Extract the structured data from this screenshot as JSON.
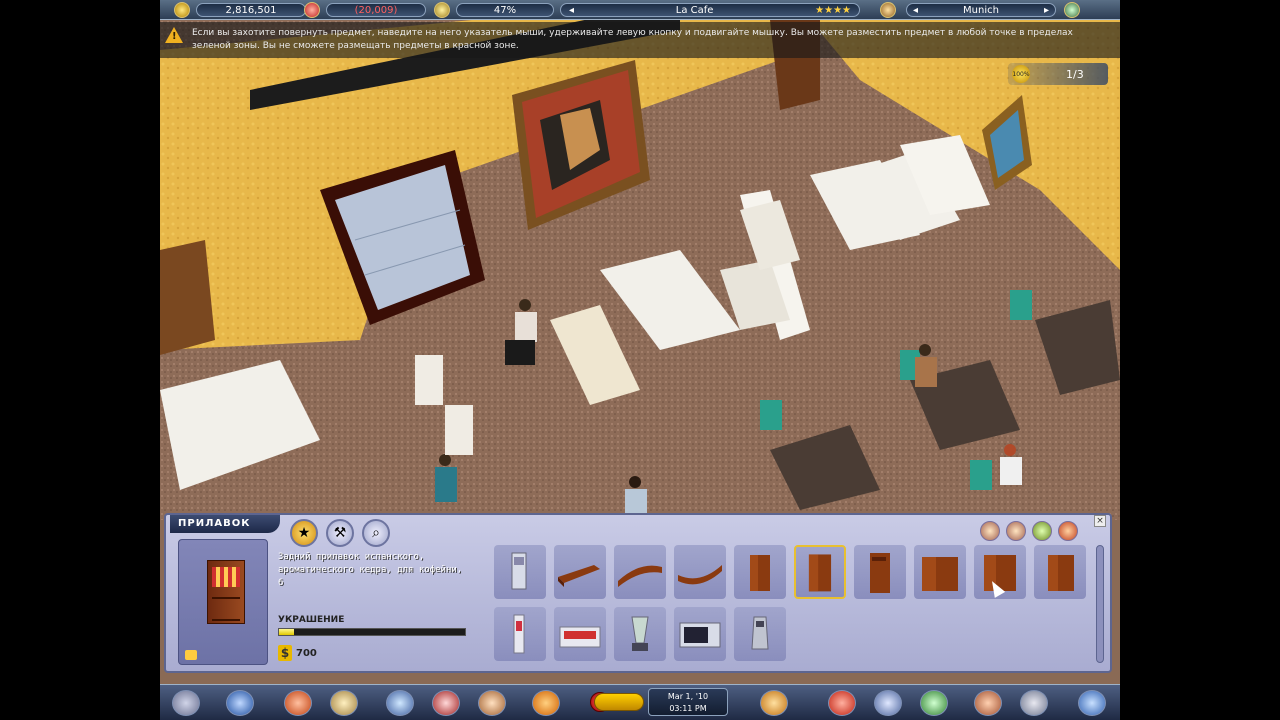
{
  "topbar": {
    "money": "2,816,501",
    "balance": "(20,009)",
    "popularity": "47%",
    "cafe_name": "La Cafe",
    "rating": "★★★★",
    "city": "Munich"
  },
  "hint": {
    "text": "Если вы захотите повернуть предмет, наведите на него указатель мыши, удерживайте левую кнопку и подвигайте мышку. Вы можете разместить предмет в любой точке в пределах зеленой зоны. Вы не сможете размещать предметы в красной зоне."
  },
  "counter": {
    "badge": "100%",
    "value": "1/3"
  },
  "panel": {
    "title": "ПРИЛАВОК",
    "description": "Задний прилавок испанского, ароматического кедра, для кофейни, 6",
    "decor_label": "УКРАШЕНИЕ",
    "decor_level": 0.08,
    "price": "700",
    "close": "×",
    "tools": [
      "star-tool",
      "hammer-tool",
      "magnifier-tool"
    ],
    "categories": [
      "category-1",
      "category-2",
      "category-3",
      "category-4"
    ],
    "items": [
      {
        "name": "coffee-machine-item",
        "selected": false
      },
      {
        "name": "counter-corner-item",
        "selected": false
      },
      {
        "name": "counter-curve-item",
        "selected": false
      },
      {
        "name": "counter-arc-item",
        "selected": false
      },
      {
        "name": "back-counter-item",
        "selected": false
      },
      {
        "name": "back-counter-tall-item",
        "selected": true
      },
      {
        "name": "back-counter-shelf-item",
        "selected": false
      },
      {
        "name": "back-counter-wide-item",
        "selected": false
      },
      {
        "name": "back-counter-double-item",
        "selected": false
      },
      {
        "name": "back-counter-end-item",
        "selected": false
      },
      {
        "name": "juicer-item",
        "selected": false
      },
      {
        "name": "dispenser-item",
        "selected": false
      },
      {
        "name": "blender-item",
        "selected": false
      },
      {
        "name": "microwave-item",
        "selected": false
      },
      {
        "name": "grinder-item",
        "selected": false
      }
    ]
  },
  "clock": {
    "date": "Mar 1, '10",
    "time": "03:11 PM"
  }
}
